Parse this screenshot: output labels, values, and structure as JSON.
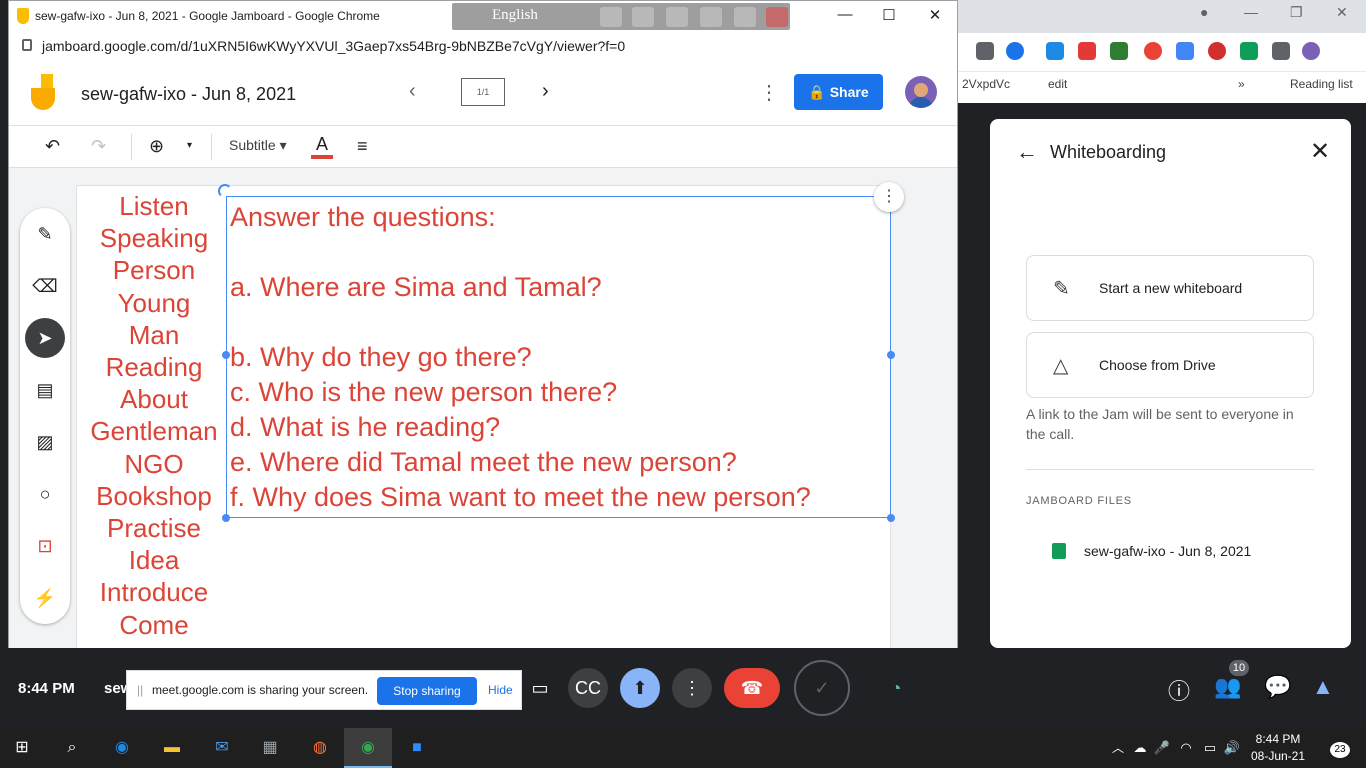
{
  "window": {
    "title": "sew-gafw-ixo - Jun 8, 2021 - Google Jamboard - Google Chrome",
    "url": "jamboard.google.com/d/1uXRN5I6wKWyYXVUl_3Gaep7xs54Brg-9bNBZBe7cVgY/viewer?f=0",
    "language": "English"
  },
  "background_browser": {
    "bookmarks": [
      "2VxpdVc",
      "edit"
    ],
    "reading_list": "Reading list"
  },
  "jamboard": {
    "doc_title": "sew-gafw-ixo - Jun 8, 2021",
    "frame_indicator": "1/1",
    "share_label": "Share",
    "font_style": "Subtitle",
    "text_color": "#db4437"
  },
  "board": {
    "words": [
      "Listen",
      "Speaking",
      "Person",
      "Young",
      "Man",
      "Reading",
      "About",
      "Gentleman",
      "NGO",
      "Bookshop",
      "Practise",
      "Idea",
      "Introduce",
      "Come"
    ],
    "questions": [
      "Answer the questions:",
      "",
      "a. Where are Sima and Tamal?",
      "",
      "b. Why do they go there?",
      "c. Who is the new person there?",
      "d. What is he reading?",
      "e. Where did Tamal meet the new person?",
      "f. Why does Sima want to meet the new person?"
    ]
  },
  "panel": {
    "title": "Whiteboarding",
    "option_new": "Start a new whiteboard",
    "option_drive": "Choose from Drive",
    "note": "A link to the Jam will be sent to everyone in the call.",
    "section_label": "JAMBOARD FILES",
    "file_name": "sew-gafw-ixo - Jun 8, 2021"
  },
  "meet": {
    "time": "8:44 PM",
    "meeting_code": "sew",
    "participant_count": "10",
    "sharing_message": "meet.google.com is sharing your screen.",
    "stop_sharing": "Stop sharing",
    "hide": "Hide"
  },
  "taskbar": {
    "time": "8:44 PM",
    "date": "08-Jun-21",
    "notifications": "23"
  },
  "icons": [
    "undo-icon",
    "redo-icon",
    "zoom-icon",
    "align-icon",
    "pen-icon",
    "eraser-icon",
    "select-icon",
    "sticky-note-icon",
    "image-icon",
    "shape-icon",
    "text-box-icon",
    "laser-icon"
  ]
}
